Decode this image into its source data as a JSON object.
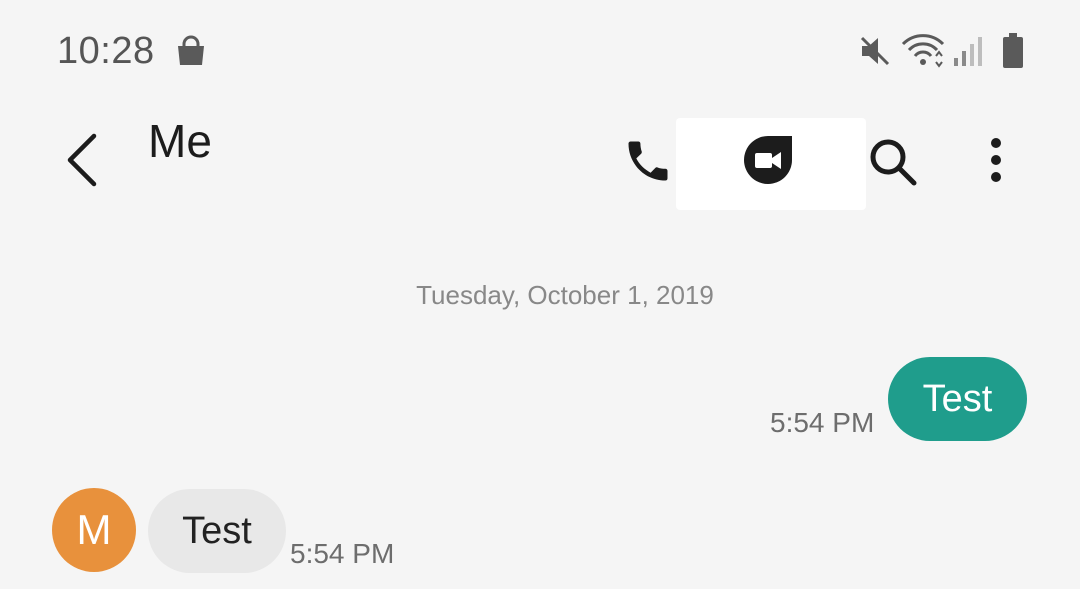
{
  "status_bar": {
    "time": "10:28",
    "icons": [
      "shopping-bag-icon",
      "mute-icon",
      "wifi-icon",
      "signal-icon",
      "battery-icon"
    ]
  },
  "header": {
    "title": "Me",
    "icons": [
      "back-icon",
      "phone-icon",
      "video-call-icon",
      "search-icon",
      "more-options-icon"
    ]
  },
  "conversation": {
    "date": "Tuesday, October 1, 2019",
    "messages": [
      {
        "direction": "sent",
        "text": "Test",
        "time": "5:54 PM"
      },
      {
        "direction": "received",
        "sender_initial": "M",
        "text": "Test",
        "time": "5:54 PM"
      }
    ]
  },
  "colors": {
    "sent_bubble": "#1f9d8c",
    "received_bubble": "#e8e8e8",
    "avatar": "#e8913c",
    "background": "#f5f5f5"
  }
}
